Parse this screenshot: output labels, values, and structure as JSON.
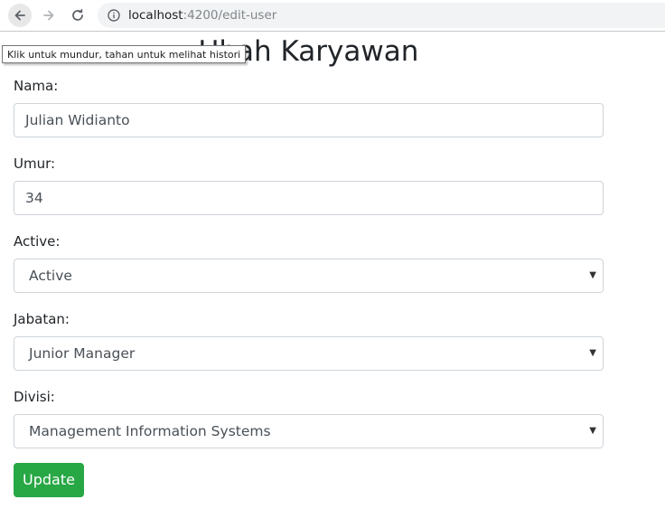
{
  "browser": {
    "url_host": "localhost",
    "url_path": ":4200/edit-user",
    "back_tooltip": "Klik untuk mundur, tahan untuk melihat histori"
  },
  "page": {
    "title": "Ubah Karyawan"
  },
  "form": {
    "nama": {
      "label": "Nama:",
      "value": "Julian Widianto"
    },
    "umur": {
      "label": "Umur:",
      "value": "34"
    },
    "active": {
      "label": "Active:",
      "value": "Active"
    },
    "jabatan": {
      "label": "Jabatan:",
      "value": "Junior Manager"
    },
    "divisi": {
      "label": "Divisi:",
      "value": "Management Information Systems"
    },
    "update_label": "Update"
  },
  "icons": {
    "back": "arrow-left-icon",
    "forward": "arrow-right-icon",
    "reload": "reload-icon",
    "info": "info-icon",
    "select_caret": "caret-down-icon"
  },
  "colors": {
    "update_button": "#28a745",
    "input_border": "#ced4da"
  }
}
